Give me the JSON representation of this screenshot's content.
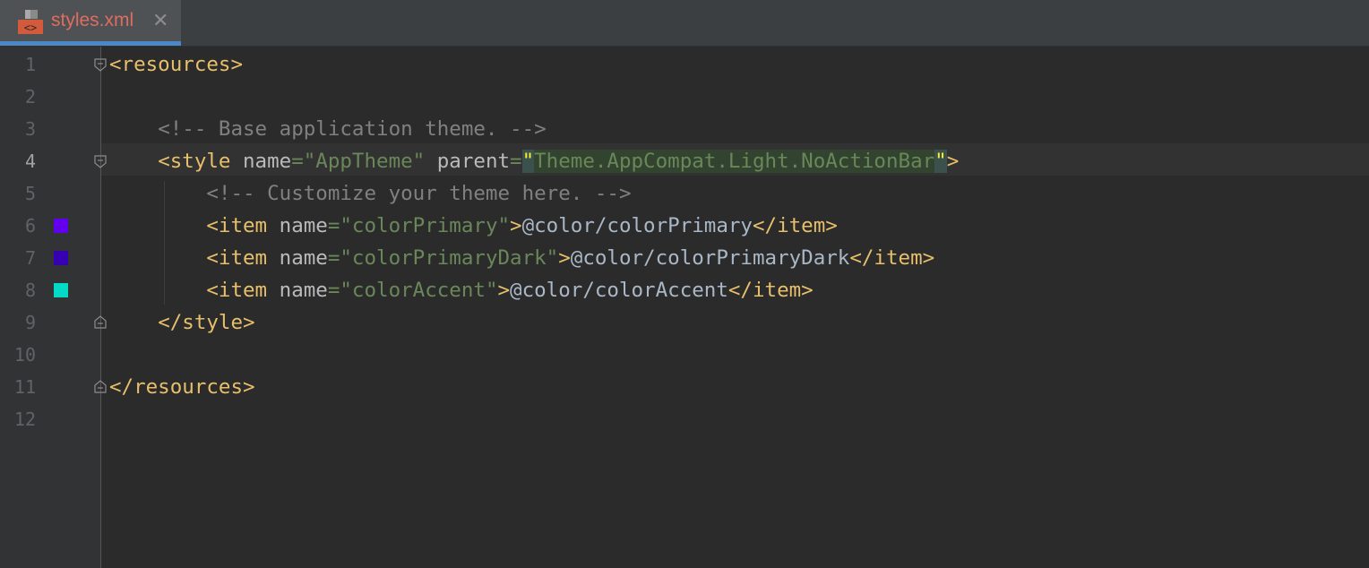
{
  "tab": {
    "title": "styles.xml",
    "close": "✕",
    "icon": "xml-file-icon",
    "icon_text": "<>"
  },
  "editor": {
    "current_line": 4,
    "line_numbers": [
      "1",
      "2",
      "3",
      "4",
      "5",
      "6",
      "7",
      "8",
      "9",
      "10",
      "11",
      "12"
    ],
    "color_swatches": {
      "6": "#6200EE",
      "7": "#3700B3",
      "8": "#03DAC5"
    },
    "lines": {
      "l1": {
        "open": "<resources>"
      },
      "l3": {
        "comment": "<!-- Base application theme. -->"
      },
      "l4": {
        "open": "<style",
        "attr1": "name",
        "eq1": "=",
        "val1": "\"AppTheme\"",
        "attr2": "parent",
        "eq2": "=",
        "q_open": "\"",
        "val2": "Theme.AppCompat.Light.NoActionBar",
        "q_close": "\"",
        "close": ">"
      },
      "l5": {
        "comment": "<!-- Customize your theme here. -->"
      },
      "l6": {
        "open": "<item",
        "attr": "name",
        "eq": "=",
        "val": "\"colorPrimary\"",
        "gt": ">",
        "text": "@color/colorPrimary",
        "close": "</item>"
      },
      "l7": {
        "open": "<item",
        "attr": "name",
        "eq": "=",
        "val": "\"colorPrimaryDark\"",
        "gt": ">",
        "text": "@color/colorPrimaryDark",
        "close": "</item>"
      },
      "l8": {
        "open": "<item",
        "attr": "name",
        "eq": "=",
        "val": "\"colorAccent\"",
        "gt": ">",
        "text": "@color/colorAccent",
        "close": "</item>"
      },
      "l9": {
        "close": "</style>"
      },
      "l11": {
        "close": "</resources>"
      }
    }
  }
}
